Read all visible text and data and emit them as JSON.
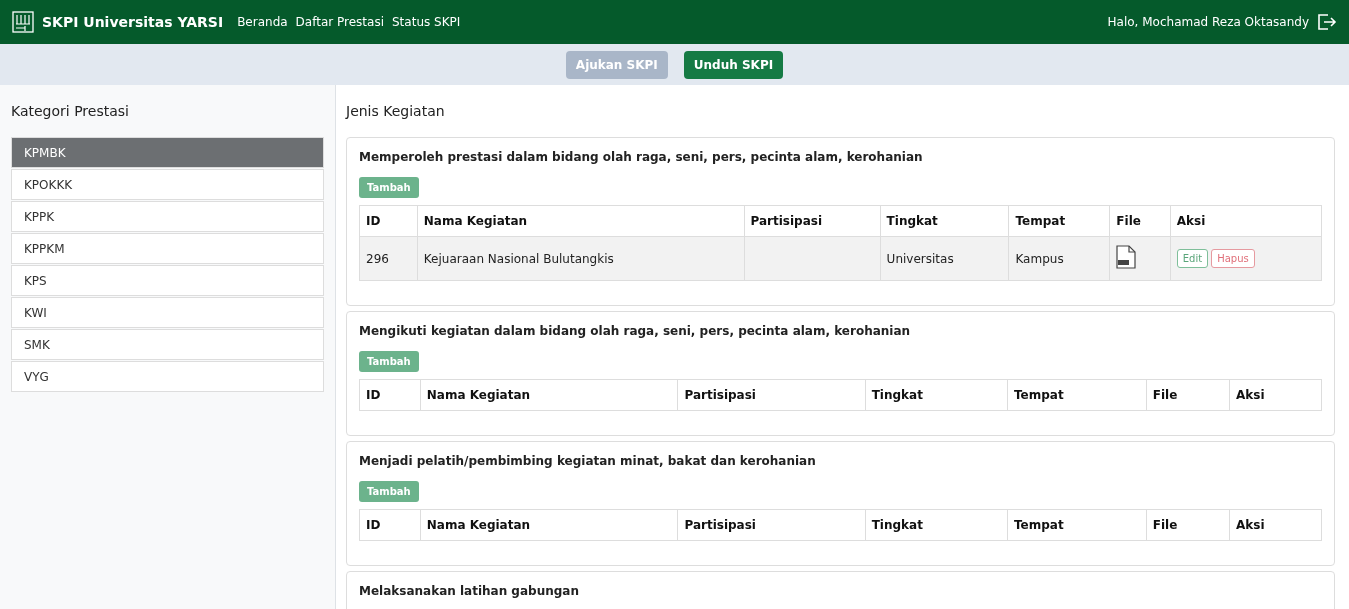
{
  "navbar": {
    "brand": "SKPI Universitas YARSI",
    "links": [
      "Beranda",
      "Daftar Prestasi",
      "Status SKPI"
    ],
    "greeting": "Halo, Mochamad Reza Oktasandy"
  },
  "actions": [
    {
      "label": "Ajukan SKPI",
      "disabled": true
    },
    {
      "label": "Unduh SKPI",
      "disabled": false
    }
  ],
  "sidebar": {
    "title": "Kategori Prestasi",
    "items": [
      {
        "label": "KPMBK",
        "selected": true
      },
      {
        "label": "KPOKKK",
        "selected": false
      },
      {
        "label": "KPPK",
        "selected": false
      },
      {
        "label": "KPPKM",
        "selected": false
      },
      {
        "label": "KPS",
        "selected": false
      },
      {
        "label": "KWI",
        "selected": false
      },
      {
        "label": "SMK",
        "selected": false
      },
      {
        "label": "VYG",
        "selected": false
      }
    ]
  },
  "content": {
    "title": "Jenis Kegiatan",
    "sections": [
      {
        "title": "Memperoleh prestasi dalam bidang olah raga, seni, pers, pecinta alam, kerohanian",
        "add_button": "Tambah",
        "columns": [
          "ID",
          "Nama Kegiatan",
          "Partisipasi",
          "Tingkat",
          "Tempat",
          "File",
          "Aksi"
        ],
        "rows": [
          {
            "id": "296",
            "name": "Kejuaraan Nasional Bulutangkis",
            "tingkat": "Universitas",
            "tempat": "Kampus",
            "has_file": true,
            "edit": "Edit",
            "delete": "Hapus"
          }
        ]
      },
      {
        "title": "Mengikuti kegiatan dalam bidang olah raga, seni, pers, pecinta alam, kerohanian",
        "add_button": "Tambah",
        "columns": [
          "ID",
          "Nama Kegiatan",
          "Partisipasi",
          "Tingkat",
          "Tempat",
          "File",
          "Aksi"
        ]
      },
      {
        "title": "Menjadi pelatih/pembimbing kegiatan minat, bakat dan kerohanian",
        "add_button": "Tambah",
        "columns": [
          "ID",
          "Nama Kegiatan",
          "Partisipasi",
          "Tingkat",
          "Tempat",
          "File",
          "Aksi"
        ]
      },
      {
        "title": "Melaksanakan latihan gabungan"
      }
    ]
  }
}
